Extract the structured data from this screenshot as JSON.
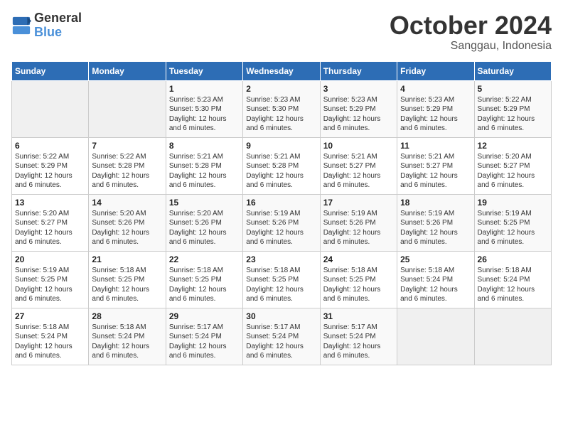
{
  "logo": {
    "line1": "General",
    "line2": "Blue"
  },
  "title": "October 2024",
  "location": "Sanggau, Indonesia",
  "days_header": [
    "Sunday",
    "Monday",
    "Tuesday",
    "Wednesday",
    "Thursday",
    "Friday",
    "Saturday"
  ],
  "weeks": [
    [
      {
        "day": "",
        "sunrise": "",
        "sunset": "",
        "daylight": ""
      },
      {
        "day": "",
        "sunrise": "",
        "sunset": "",
        "daylight": ""
      },
      {
        "day": "1",
        "sunrise": "Sunrise: 5:23 AM",
        "sunset": "Sunset: 5:30 PM",
        "daylight": "Daylight: 12 hours and 6 minutes."
      },
      {
        "day": "2",
        "sunrise": "Sunrise: 5:23 AM",
        "sunset": "Sunset: 5:30 PM",
        "daylight": "Daylight: 12 hours and 6 minutes."
      },
      {
        "day": "3",
        "sunrise": "Sunrise: 5:23 AM",
        "sunset": "Sunset: 5:29 PM",
        "daylight": "Daylight: 12 hours and 6 minutes."
      },
      {
        "day": "4",
        "sunrise": "Sunrise: 5:23 AM",
        "sunset": "Sunset: 5:29 PM",
        "daylight": "Daylight: 12 hours and 6 minutes."
      },
      {
        "day": "5",
        "sunrise": "Sunrise: 5:22 AM",
        "sunset": "Sunset: 5:29 PM",
        "daylight": "Daylight: 12 hours and 6 minutes."
      }
    ],
    [
      {
        "day": "6",
        "sunrise": "Sunrise: 5:22 AM",
        "sunset": "Sunset: 5:29 PM",
        "daylight": "Daylight: 12 hours and 6 minutes."
      },
      {
        "day": "7",
        "sunrise": "Sunrise: 5:22 AM",
        "sunset": "Sunset: 5:28 PM",
        "daylight": "Daylight: 12 hours and 6 minutes."
      },
      {
        "day": "8",
        "sunrise": "Sunrise: 5:21 AM",
        "sunset": "Sunset: 5:28 PM",
        "daylight": "Daylight: 12 hours and 6 minutes."
      },
      {
        "day": "9",
        "sunrise": "Sunrise: 5:21 AM",
        "sunset": "Sunset: 5:28 PM",
        "daylight": "Daylight: 12 hours and 6 minutes."
      },
      {
        "day": "10",
        "sunrise": "Sunrise: 5:21 AM",
        "sunset": "Sunset: 5:27 PM",
        "daylight": "Daylight: 12 hours and 6 minutes."
      },
      {
        "day": "11",
        "sunrise": "Sunrise: 5:21 AM",
        "sunset": "Sunset: 5:27 PM",
        "daylight": "Daylight: 12 hours and 6 minutes."
      },
      {
        "day": "12",
        "sunrise": "Sunrise: 5:20 AM",
        "sunset": "Sunset: 5:27 PM",
        "daylight": "Daylight: 12 hours and 6 minutes."
      }
    ],
    [
      {
        "day": "13",
        "sunrise": "Sunrise: 5:20 AM",
        "sunset": "Sunset: 5:27 PM",
        "daylight": "Daylight: 12 hours and 6 minutes."
      },
      {
        "day": "14",
        "sunrise": "Sunrise: 5:20 AM",
        "sunset": "Sunset: 5:26 PM",
        "daylight": "Daylight: 12 hours and 6 minutes."
      },
      {
        "day": "15",
        "sunrise": "Sunrise: 5:20 AM",
        "sunset": "Sunset: 5:26 PM",
        "daylight": "Daylight: 12 hours and 6 minutes."
      },
      {
        "day": "16",
        "sunrise": "Sunrise: 5:19 AM",
        "sunset": "Sunset: 5:26 PM",
        "daylight": "Daylight: 12 hours and 6 minutes."
      },
      {
        "day": "17",
        "sunrise": "Sunrise: 5:19 AM",
        "sunset": "Sunset: 5:26 PM",
        "daylight": "Daylight: 12 hours and 6 minutes."
      },
      {
        "day": "18",
        "sunrise": "Sunrise: 5:19 AM",
        "sunset": "Sunset: 5:26 PM",
        "daylight": "Daylight: 12 hours and 6 minutes."
      },
      {
        "day": "19",
        "sunrise": "Sunrise: 5:19 AM",
        "sunset": "Sunset: 5:25 PM",
        "daylight": "Daylight: 12 hours and 6 minutes."
      }
    ],
    [
      {
        "day": "20",
        "sunrise": "Sunrise: 5:19 AM",
        "sunset": "Sunset: 5:25 PM",
        "daylight": "Daylight: 12 hours and 6 minutes."
      },
      {
        "day": "21",
        "sunrise": "Sunrise: 5:18 AM",
        "sunset": "Sunset: 5:25 PM",
        "daylight": "Daylight: 12 hours and 6 minutes."
      },
      {
        "day": "22",
        "sunrise": "Sunrise: 5:18 AM",
        "sunset": "Sunset: 5:25 PM",
        "daylight": "Daylight: 12 hours and 6 minutes."
      },
      {
        "day": "23",
        "sunrise": "Sunrise: 5:18 AM",
        "sunset": "Sunset: 5:25 PM",
        "daylight": "Daylight: 12 hours and 6 minutes."
      },
      {
        "day": "24",
        "sunrise": "Sunrise: 5:18 AM",
        "sunset": "Sunset: 5:25 PM",
        "daylight": "Daylight: 12 hours and 6 minutes."
      },
      {
        "day": "25",
        "sunrise": "Sunrise: 5:18 AM",
        "sunset": "Sunset: 5:24 PM",
        "daylight": "Daylight: 12 hours and 6 minutes."
      },
      {
        "day": "26",
        "sunrise": "Sunrise: 5:18 AM",
        "sunset": "Sunset: 5:24 PM",
        "daylight": "Daylight: 12 hours and 6 minutes."
      }
    ],
    [
      {
        "day": "27",
        "sunrise": "Sunrise: 5:18 AM",
        "sunset": "Sunset: 5:24 PM",
        "daylight": "Daylight: 12 hours and 6 minutes."
      },
      {
        "day": "28",
        "sunrise": "Sunrise: 5:18 AM",
        "sunset": "Sunset: 5:24 PM",
        "daylight": "Daylight: 12 hours and 6 minutes."
      },
      {
        "day": "29",
        "sunrise": "Sunrise: 5:17 AM",
        "sunset": "Sunset: 5:24 PM",
        "daylight": "Daylight: 12 hours and 6 minutes."
      },
      {
        "day": "30",
        "sunrise": "Sunrise: 5:17 AM",
        "sunset": "Sunset: 5:24 PM",
        "daylight": "Daylight: 12 hours and 6 minutes."
      },
      {
        "day": "31",
        "sunrise": "Sunrise: 5:17 AM",
        "sunset": "Sunset: 5:24 PM",
        "daylight": "Daylight: 12 hours and 6 minutes."
      },
      {
        "day": "",
        "sunrise": "",
        "sunset": "",
        "daylight": ""
      },
      {
        "day": "",
        "sunrise": "",
        "sunset": "",
        "daylight": ""
      }
    ]
  ]
}
